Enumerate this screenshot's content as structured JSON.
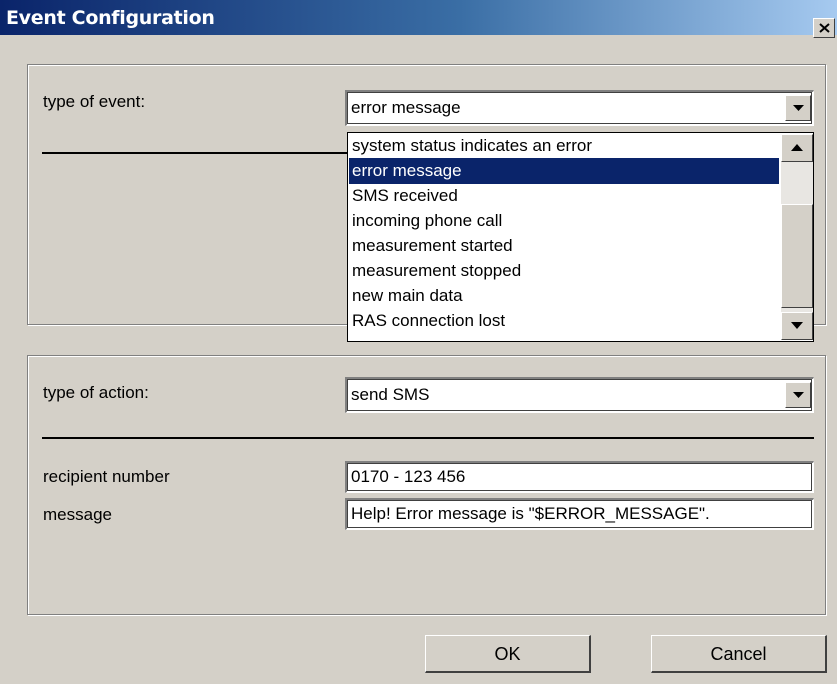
{
  "window": {
    "title": "Event Configuration"
  },
  "event": {
    "label": "type of event:",
    "selected": "error message",
    "options": [
      "system status indicates an error",
      "error message",
      "SMS received",
      "incoming phone call",
      "measurement started",
      "measurement stopped",
      "new main data",
      "RAS connection lost"
    ]
  },
  "action": {
    "label": "type of action:",
    "selected": "send SMS",
    "recipient_label": "recipient number",
    "recipient_value": "0170 - 123 456",
    "message_label": "message",
    "message_value": "Help! Error message is \"$ERROR_MESSAGE\"."
  },
  "buttons": {
    "ok": "OK",
    "cancel": "Cancel"
  },
  "colors": {
    "selection": "#0a246a",
    "face": "#d4d0c8"
  },
  "icons": {
    "close": "close-icon",
    "dropdown": "chevron-down-icon",
    "scroll_up": "arrow-up-icon",
    "scroll_down": "arrow-down-icon"
  }
}
